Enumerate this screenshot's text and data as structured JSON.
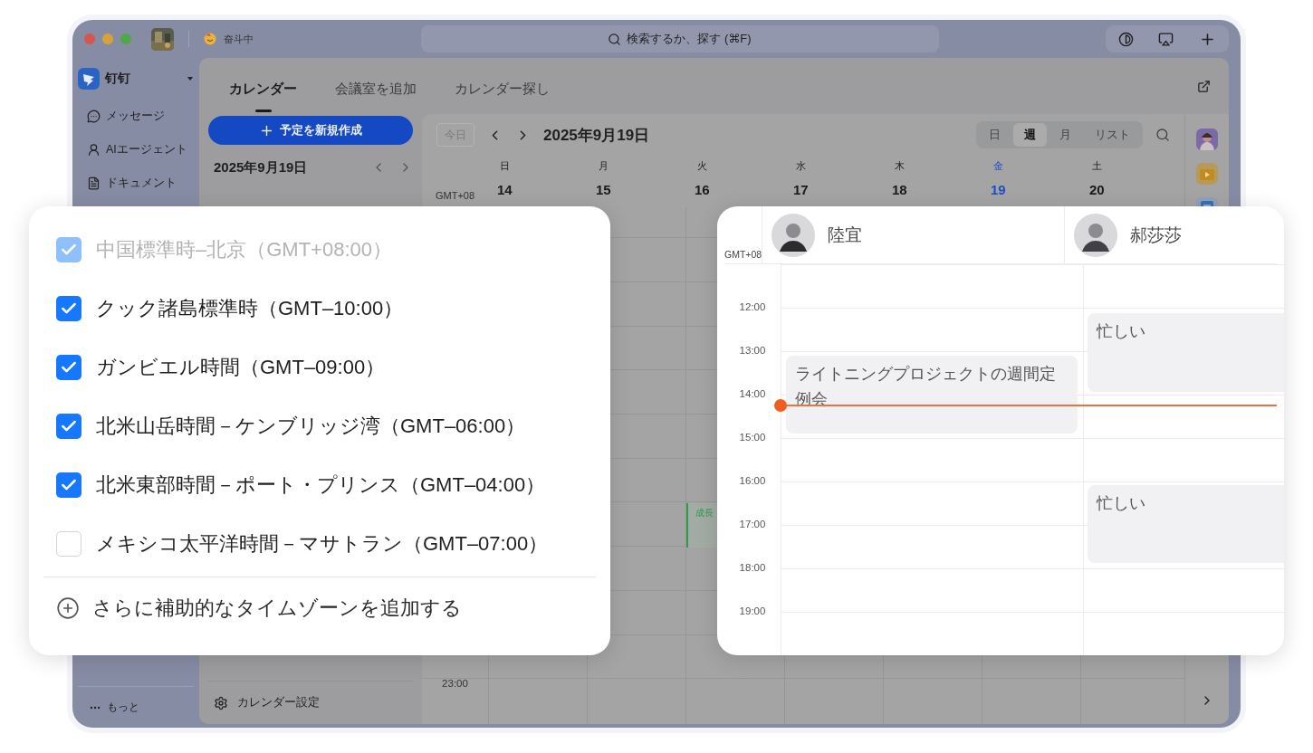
{
  "title_bar": {
    "status": "奋斗中",
    "search": {
      "placeholder": "検索するか、探す (⌘F)"
    }
  },
  "sidebar": {
    "app_name": "钉钉",
    "items": [
      {
        "label": "メッセージ"
      },
      {
        "label": "AIエージェント"
      },
      {
        "label": "ドキュメント"
      }
    ],
    "more": "もっと"
  },
  "tabs": [
    {
      "label": "カレンダー",
      "selected": true
    },
    {
      "label": "会議室を追加",
      "selected": false
    },
    {
      "label": "カレンダー探し",
      "selected": false
    }
  ],
  "new_event_button": "予定を新規作成",
  "mini_calendar": {
    "title": "2025年9月19日"
  },
  "settings": "カレンダー設定",
  "calendar": {
    "today_button": "今日",
    "title": "2025年9月19日",
    "views": [
      {
        "label": "日",
        "selected": false
      },
      {
        "label": "週",
        "selected": true
      },
      {
        "label": "月",
        "selected": false
      },
      {
        "label": "リスト",
        "selected": false
      }
    ],
    "timezone": "GMT+08",
    "days": [
      {
        "name": "日",
        "date": "14",
        "selected": false
      },
      {
        "name": "月",
        "date": "15",
        "selected": false
      },
      {
        "name": "火",
        "date": "16",
        "selected": false,
        "events": [
          {
            "title": "成長",
            "color": "#2f9a4c"
          }
        ]
      },
      {
        "name": "水",
        "date": "17",
        "selected": false
      },
      {
        "name": "木",
        "date": "18",
        "selected": false
      },
      {
        "name": "金",
        "date": "19",
        "selected": true
      },
      {
        "name": "土",
        "date": "20",
        "selected": false
      }
    ],
    "hours": [
      "23:00"
    ]
  },
  "timezone_card": {
    "zones": [
      {
        "label": "中国標準時–北京（GMT+08:00）",
        "checked": true,
        "disabled": true
      },
      {
        "label": "クック諸島標準時（GMT–10:00）",
        "checked": true,
        "disabled": false
      },
      {
        "label": "ガンビエル時間（GMT–09:00）",
        "checked": true,
        "disabled": false
      },
      {
        "label": "北米山岳時間－ケンブリッジ湾（GMT–06:00）",
        "checked": true,
        "disabled": false
      },
      {
        "label": "北米東部時間－ポート・プリンス（GMT–04:00）",
        "checked": true,
        "disabled": false
      },
      {
        "label": "メキシコ太平洋時間－マサトラン（GMT–07:00）",
        "checked": false,
        "disabled": false
      }
    ],
    "add_label": "さらに補助的なタイムゾーンを追加する"
  },
  "schedule_card": {
    "timezone": "GMT+08",
    "hours": [
      "12:00",
      "13:00",
      "14:00",
      "15:00",
      "16:00",
      "17:00",
      "18:00",
      "19:00"
    ],
    "people": [
      {
        "name": "陸宜",
        "events": [
          {
            "title": "ライトニングプロジェクトの週間定例会"
          }
        ]
      },
      {
        "name": "郝莎莎",
        "events": [
          {
            "title": "忙しい"
          },
          {
            "title": "忙しい"
          }
        ]
      }
    ]
  }
}
